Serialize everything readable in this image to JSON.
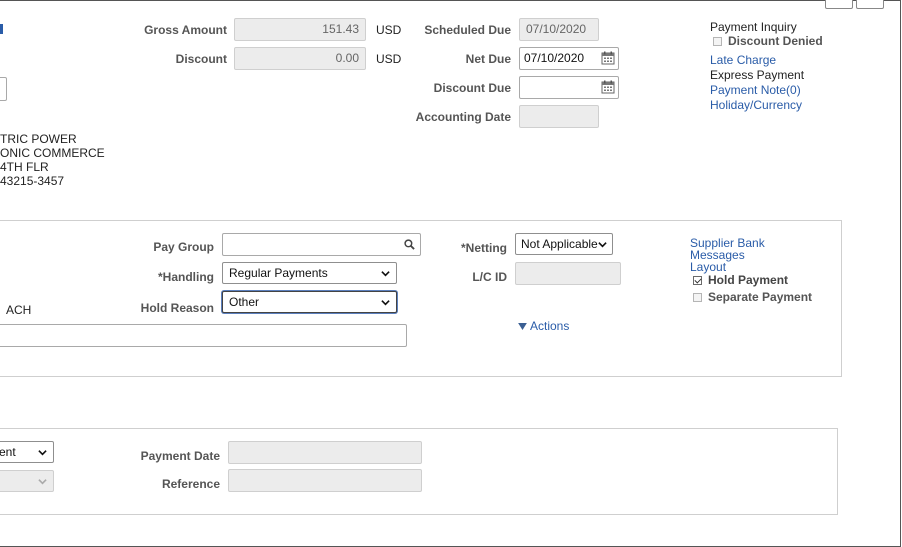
{
  "amounts": {
    "gross_amount_label": "Gross Amount",
    "gross_amount_value": "151.43",
    "gross_currency": "USD",
    "discount_label": "Discount",
    "discount_value": "0.00",
    "discount_currency": "USD"
  },
  "dates": {
    "scheduled_due_label": "Scheduled Due",
    "scheduled_due_value": "07/10/2020",
    "net_due_label": "Net Due",
    "net_due_value": "07/10/2020",
    "discount_due_label": "Discount Due",
    "discount_due_value": "",
    "accounting_date_label": "Accounting Date",
    "accounting_date_value": ""
  },
  "right_links": {
    "payment_inquiry": "Payment Inquiry",
    "discount_denied": "Discount Denied",
    "discount_denied_checked": false,
    "late_charge": "Late Charge",
    "express_payment": "Express Payment",
    "payment_note": "Payment Note(0)",
    "holiday_currency": "Holiday/Currency"
  },
  "address": {
    "line1": "TRIC POWER",
    "line2": "ONIC COMMERCE",
    "line3": "4TH FLR",
    "line4": "43215-3457"
  },
  "payment_options": {
    "pay_group_label": "Pay Group",
    "pay_group_value": "",
    "handling_label": "*Handling",
    "handling_value": "Regular Payments",
    "hold_reason_label": "Hold Reason",
    "hold_reason_value": "Other",
    "method_value": "ACH",
    "netting_label": "*Netting",
    "netting_value": "Not Applicable",
    "lc_id_label": "L/C ID",
    "lc_id_value": "",
    "actions_label": "Actions",
    "supplier_bank_messages_layout": [
      "Supplier Bank",
      "Messages",
      "Layout"
    ],
    "hold_payment_label": "Hold Payment",
    "hold_payment_checked": true,
    "separate_payment_label": "Separate Payment",
    "separate_payment_checked": false
  },
  "payment_info": {
    "action_select_value": "ent",
    "payment_date_label": "Payment Date",
    "payment_date_value": "",
    "reference_label": "Reference",
    "reference_value": ""
  },
  "icons": {
    "search": "search-icon",
    "calendar": "calendar-icon",
    "chevron": "chevron-down-icon",
    "triangle": "triangle-down-icon"
  },
  "colors": {
    "link": "#2a5ca8",
    "label": "#555555",
    "readonly_bg": "#ececec"
  }
}
